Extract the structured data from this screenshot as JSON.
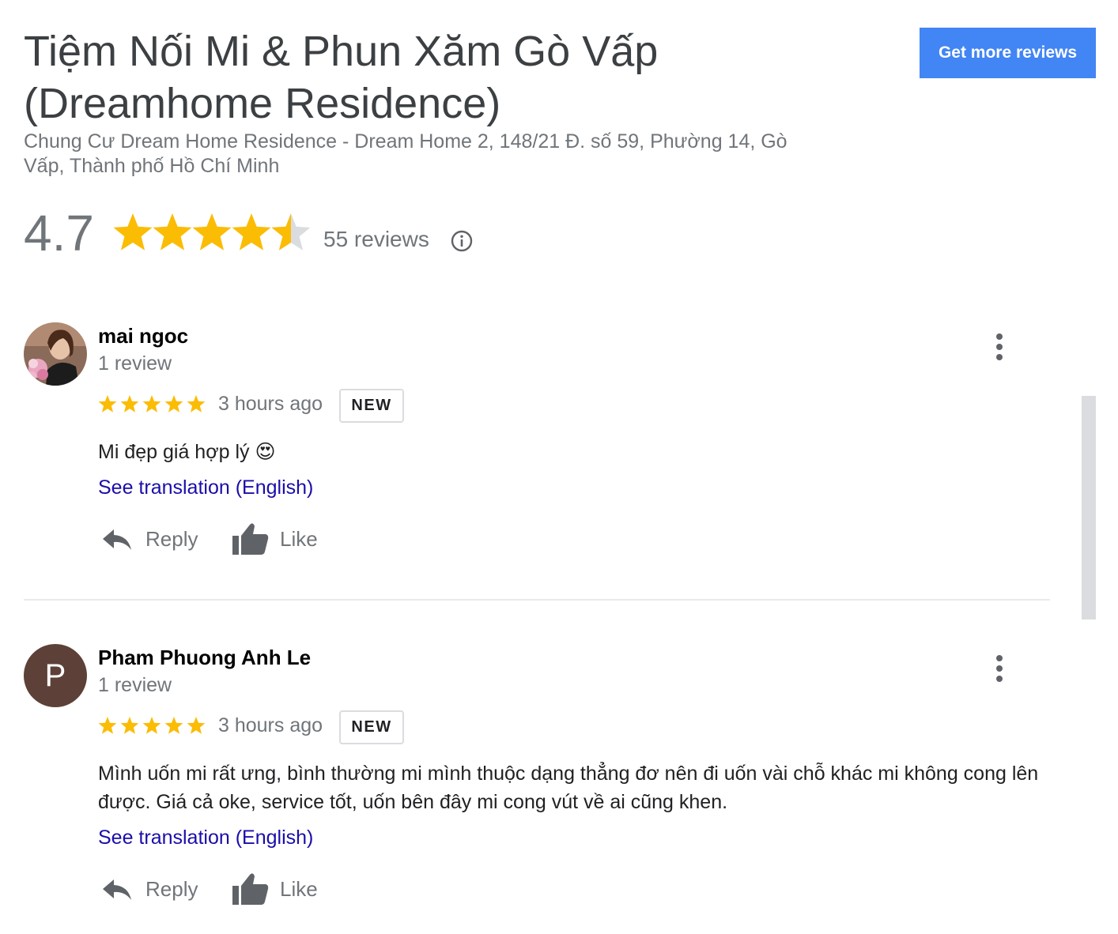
{
  "business": {
    "title": "Tiệm Nối Mi & Phun Xăm Gò Vấp (Dreamhome Residence)",
    "address": "Chung Cư Dream Home Residence - Dream Home 2, 148/21 Đ. số 59, Phường 14, Gò Vấp, Thành phố Hồ Chí Minh"
  },
  "header": {
    "get_more_reviews_label": "Get more reviews"
  },
  "summary": {
    "rating": "4.7",
    "rating_stars": 4.7,
    "review_count": "55 reviews",
    "info_icon": "info-icon"
  },
  "reviews": [
    {
      "name": "mai ngoc",
      "meta": "1 review",
      "stars": 5,
      "time": "3 hours ago",
      "badge": "NEW",
      "text": "Mi đẹp giá hợp lý 😍",
      "translation_link": "See translation (English)",
      "reply_label": "Reply",
      "like_label": "Like",
      "avatar": "photo"
    },
    {
      "name": "Pham Phuong Anh Le",
      "meta": "1 review",
      "stars": 5,
      "time": "3 hours ago",
      "badge": "NEW",
      "text": "Mình uốn mi rất ưng, bình thường mi mình thuộc dạng thẳng đơ nên đi uốn vài chỗ khác mi không cong lên được. Giá cả oke, service tốt, uốn bên đây mi cong vút về ai cũng khen.",
      "translation_link": "See translation (English)",
      "reply_label": "Reply",
      "like_label": "Like",
      "avatar_letter": "P"
    }
  ],
  "colors": {
    "accent_button": "#4285f4",
    "star": "#fbbc04",
    "link": "#1a0dab",
    "secondary_text": "#70757a"
  }
}
